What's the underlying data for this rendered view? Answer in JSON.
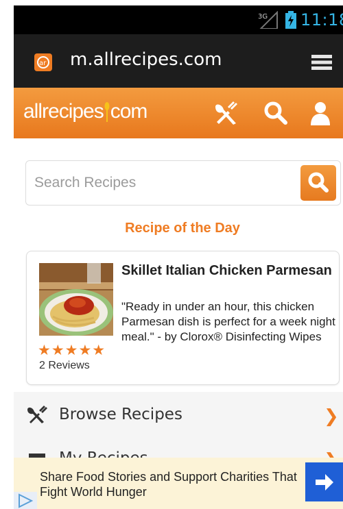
{
  "status_bar": {
    "signal_label": "3G",
    "time": "11:18"
  },
  "browser": {
    "url": "m.allrecipes.com",
    "favicon": "allrecipes-favicon",
    "menu_icon": "hamburger-menu-icon"
  },
  "site_header": {
    "logo_text_left": "allrecipes",
    "logo_text_right": "com",
    "icons": [
      "utensils-icon",
      "search-icon",
      "user-icon"
    ]
  },
  "search": {
    "placeholder": "Search Recipes",
    "value": "",
    "button_icon": "search-icon"
  },
  "recipe_of_day": {
    "heading": "Recipe of the Day",
    "title": "Skillet Italian Chicken Parmesan",
    "description": "\"Ready in under an hour, this chicken Parmesan dish is perfect for a week night meal.\" - by Clorox® Disinfecting Wipes",
    "rating_stars": 5,
    "stars_text": "★★★★★",
    "reviews": "2 Reviews"
  },
  "nav": {
    "items": [
      {
        "label": "Browse Recipes",
        "icon": "utensils-icon"
      },
      {
        "label": "My Recipes",
        "icon": "recipe-box-icon"
      }
    ]
  },
  "ad": {
    "text": "Share Food Stories and Support Charities That Fight World Hunger",
    "button_icon": "arrow-right-icon"
  },
  "colors": {
    "brand_orange": "#ef7c23",
    "status_blue": "#35b5e5",
    "ad_blue": "#1f5fd6",
    "ad_bg": "#fcf3d7"
  }
}
